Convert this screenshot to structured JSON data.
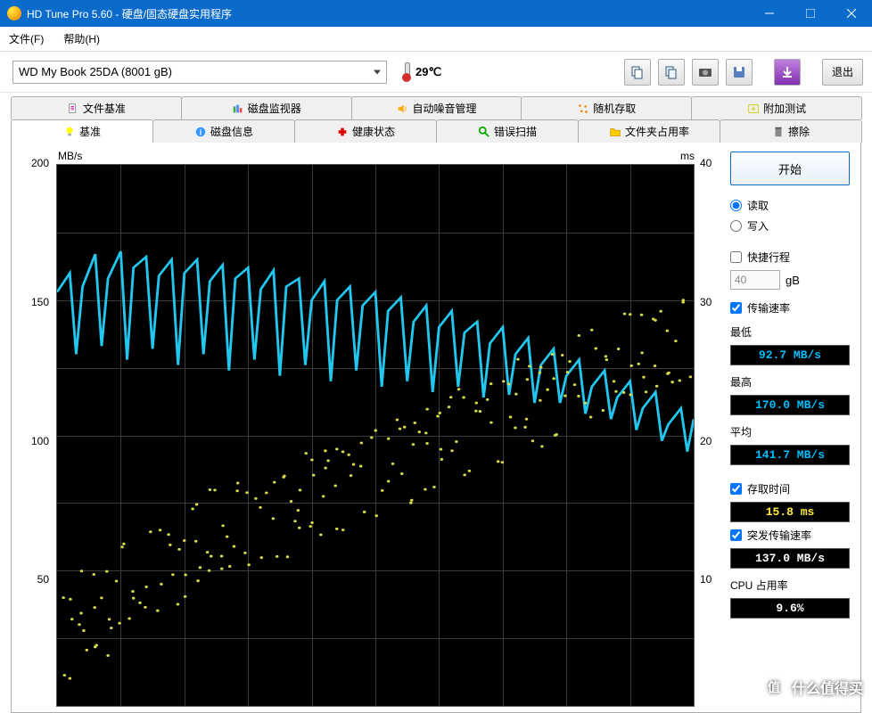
{
  "window": {
    "title": "HD Tune Pro 5.60 - 硬盘/固态硬盘实用程序"
  },
  "menu": {
    "file": "文件(F)",
    "help": "帮助(H)"
  },
  "toolbar": {
    "drive": "WD   My Book 25DA (8001 gB)",
    "temperature": "29℃",
    "exit": "退出"
  },
  "tabs_top": [
    {
      "label": "文件基准",
      "icon": "file-bench-icon"
    },
    {
      "label": "磁盘监视器",
      "icon": "monitor-icon"
    },
    {
      "label": "自动噪音管理",
      "icon": "speaker-icon"
    },
    {
      "label": "随机存取",
      "icon": "random-icon"
    },
    {
      "label": "附加测试",
      "icon": "extra-icon"
    }
  ],
  "tabs_bottom": [
    {
      "label": "基准",
      "icon": "bulb-icon",
      "active": true
    },
    {
      "label": "磁盘信息",
      "icon": "info-icon"
    },
    {
      "label": "健康状态",
      "icon": "health-icon"
    },
    {
      "label": "错误扫描",
      "icon": "scan-icon"
    },
    {
      "label": "文件夹占用率",
      "icon": "folder-icon"
    },
    {
      "label": "擦除",
      "icon": "erase-icon"
    }
  ],
  "side": {
    "start": "开始",
    "read": "读取",
    "write": "写入",
    "short": "快捷行程",
    "short_val": "40",
    "short_unit": "gB",
    "transfer": "传输速率",
    "min_label": "最低",
    "min_val": "92.7 MB/s",
    "max_label": "最高",
    "max_val": "170.0 MB/s",
    "avg_label": "平均",
    "avg_val": "141.7 MB/s",
    "access": "存取时间",
    "access_val": "15.8 ms",
    "burst": "突发传输速率",
    "burst_val": "137.0 MB/s",
    "cpu": "CPU 占用率",
    "cpu_val": "9.6%"
  },
  "chart_data": {
    "type": "line",
    "y_left_label": "MB/s",
    "y_left_ticks": [
      200,
      150,
      100,
      50
    ],
    "y_left_range": [
      0,
      200
    ],
    "y_right_label": "ms",
    "y_right_ticks": [
      40,
      30,
      20,
      10
    ],
    "y_right_range": [
      0,
      40
    ],
    "series": [
      {
        "name": "transfer_rate_MBps",
        "axis": "left",
        "color": "#22c7f0",
        "x_pct": [
          0,
          2,
          4,
          6,
          8,
          10,
          12,
          14,
          16,
          18,
          20,
          22,
          24,
          26,
          28,
          30,
          32,
          34,
          36,
          38,
          40,
          42,
          44,
          46,
          48,
          50,
          52,
          54,
          56,
          58,
          60,
          62,
          64,
          66,
          68,
          70,
          72,
          74,
          76,
          78,
          80,
          82,
          84,
          86,
          88,
          90,
          92,
          94,
          96,
          98,
          100
        ],
        "values": [
          153,
          160,
          155,
          167,
          158,
          168,
          162,
          166,
          159,
          165,
          160,
          165,
          157,
          163,
          158,
          162,
          154,
          161,
          155,
          158,
          150,
          157,
          150,
          155,
          148,
          153,
          146,
          151,
          142,
          148,
          140,
          146,
          138,
          142,
          134,
          140,
          130,
          136,
          126,
          132,
          122,
          128,
          118,
          124,
          114,
          120,
          110,
          116,
          104,
          110,
          106
        ]
      },
      {
        "name": "transfer_rate_dips_MBps",
        "axis": "left",
        "color": "#22c7f0",
        "x_pct": [
          3,
          7,
          11,
          15,
          19,
          23,
          27,
          31,
          35,
          39,
          43,
          47,
          51,
          55,
          59,
          63,
          67,
          71,
          75,
          79,
          83,
          87,
          91,
          95,
          99
        ],
        "values": [
          130,
          133,
          128,
          132,
          126,
          130,
          124,
          128,
          122,
          126,
          120,
          124,
          118,
          120,
          116,
          118,
          114,
          115,
          112,
          112,
          108,
          106,
          102,
          98,
          94
        ]
      },
      {
        "name": "access_time_ms",
        "axis": "right",
        "type": "scatter",
        "color": "#d4d94a",
        "x_pct": [
          1,
          3,
          5,
          7,
          9,
          11,
          13,
          15,
          17,
          19,
          21,
          23,
          25,
          27,
          29,
          31,
          33,
          35,
          37,
          39,
          41,
          43,
          45,
          47,
          49,
          51,
          53,
          55,
          57,
          59,
          61,
          63,
          65,
          67,
          69,
          71,
          73,
          75,
          77,
          79,
          81,
          83,
          85,
          87,
          89,
          91,
          93,
          95,
          97,
          99
        ],
        "values": [
          5,
          6,
          7,
          6,
          8,
          9,
          8,
          10,
          11,
          10,
          12,
          11,
          13,
          12,
          14,
          13,
          15,
          14,
          15,
          16,
          15,
          17,
          16,
          18,
          17,
          18,
          19,
          18,
          20,
          19,
          20,
          21,
          20,
          22,
          21,
          22,
          23,
          22,
          24,
          23,
          24,
          25,
          24,
          25,
          26,
          25,
          26,
          27,
          26,
          27
        ]
      }
    ]
  },
  "watermark": "什么值得买"
}
